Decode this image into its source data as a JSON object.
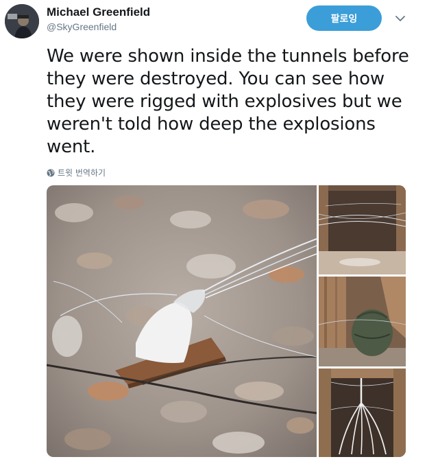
{
  "author": {
    "display_name": "Michael Greenfield",
    "handle": "@SkyGreenfield"
  },
  "follow_label": "팔로잉",
  "tweet": {
    "lines": [
      "We were shown inside the tunnels before",
      "they were destroyed. You can see how",
      "they were rigged with explosives but we",
      "weren't told how deep the explosions",
      "went."
    ]
  },
  "translate_label": "트윗 번역하기",
  "colors": {
    "accent": "#3b9ed8",
    "secondary_text": "#657786",
    "primary_text": "#14171a"
  },
  "icons": [
    "chevron-down-icon",
    "globe-icon"
  ]
}
